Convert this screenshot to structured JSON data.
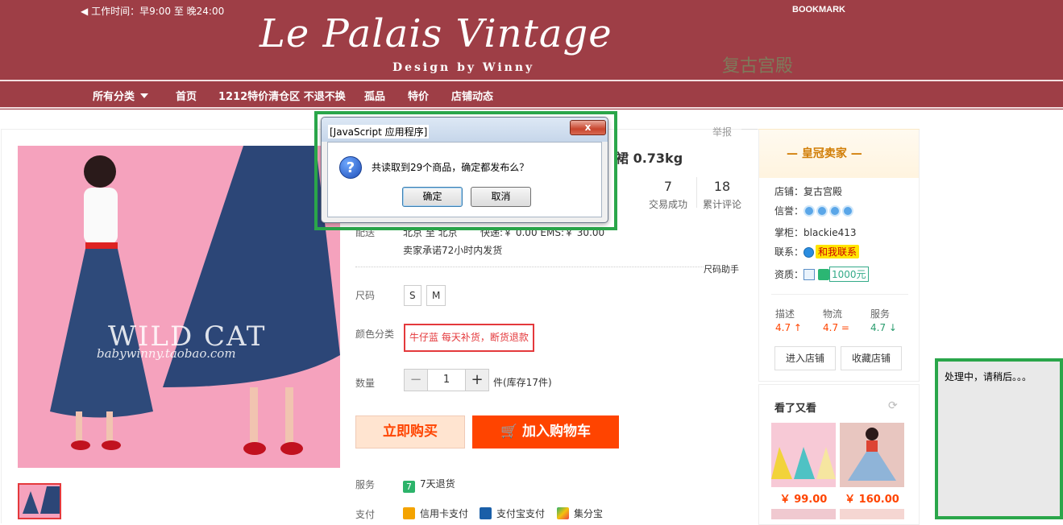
{
  "header": {
    "hours": "工作时间：早9:00 至 晚24:00",
    "bookmark": "BOOKMARK",
    "logo_text": "Le Palais Vintage",
    "tagline": "Design by Winny",
    "cn_name": "复古宫殿",
    "nav": [
      "所有分类",
      "首页",
      "1212特价清仓区 不退不换",
      "孤品",
      "特价",
      "店铺动态"
    ]
  },
  "product": {
    "report": "举报",
    "title_fragment": "裙 0.73kg",
    "stats": [
      {
        "value": "7",
        "label": "交易成功"
      },
      {
        "value": "18",
        "label": "累计评论"
      }
    ],
    "ship_from_label": "配送",
    "ship_route": "北京 至 北京",
    "ship_fee": "快递:￥ 0.00  EMS:￥ 30.00",
    "promise": "卖家承诺72小时内发货",
    "size_help": "尺码助手",
    "size_label": "尺码",
    "sizes": [
      "S",
      "M"
    ],
    "color_label": "颜色分类",
    "color_option": "牛仔蓝 每天补货，断货退款",
    "qty_label": "数量",
    "qty_minus": "−",
    "qty_value": "1",
    "qty_plus": "+",
    "stock": "件(库存17件)",
    "buy_now": "立即购买",
    "add_cart": "加入购物车",
    "service_label": "服务",
    "service_icon_text": "7",
    "service": "7天退货",
    "pay_label": "支付",
    "payments": [
      "信用卡支付",
      "支付宝支付",
      "集分宝"
    ],
    "watermark_title": "WILD CAT",
    "watermark_url": "babywinny.taobao.com"
  },
  "seller": {
    "badge": "皇冠卖家",
    "shop_label": "店铺：",
    "shop": "复古宫殿",
    "credit_label": "信誉：",
    "owner_label": "掌柜：",
    "owner": "blackie413",
    "contact_label": "联系：",
    "contact": "和我联系",
    "qual_label": "资质：",
    "deposit": "1000元",
    "scores": [
      {
        "name": "描述",
        "value": "4.7 ↑",
        "color": "#f40"
      },
      {
        "name": "物流",
        "value": "4.7 =",
        "color": "#f40"
      },
      {
        "name": "服务",
        "value": "4.7 ↓",
        "color": "#2a9c6e"
      }
    ],
    "enter_shop": "进入店铺",
    "fav_shop": "收藏店铺"
  },
  "related": {
    "title": "看了又看",
    "items": [
      {
        "price": "￥ 99.00"
      },
      {
        "price": "￥ 160.00"
      }
    ]
  },
  "dialog": {
    "title": "[JavaScript 应用程序]",
    "close": "x",
    "message": "共读取到29个商品，确定都发布么？",
    "ok": "确定",
    "cancel": "取消"
  },
  "processing": {
    "text": "处理中，请稍后。。。"
  }
}
